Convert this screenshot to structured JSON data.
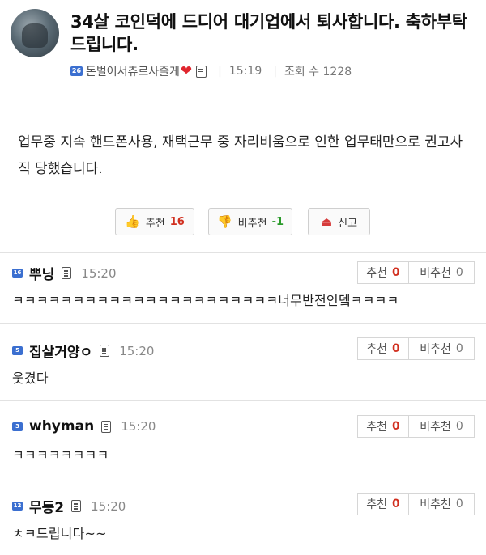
{
  "post": {
    "title": "34살 코인덕에 드디어 대기업에서 퇴사합니다. 축하부탁드립니다.",
    "author_level": "26",
    "author": "돈벌어서츄르사줄게",
    "time": "15:19",
    "views_label": "조회 수",
    "views": "1228",
    "body": "업무중 지속 핸드폰사용, 재택근무 중 자리비움으로 인한 업무태만으로 권고사직 당했습니다."
  },
  "votes": {
    "up_label": "추천",
    "up_count": "16",
    "down_label": "비추천",
    "down_count": "-1",
    "report_label": "신고"
  },
  "comments": [
    {
      "level": "16",
      "nick": "뿌닝",
      "time": "15:20",
      "up_label": "추천",
      "up": "0",
      "down_label": "비추천",
      "down": "0",
      "text": "ㅋㅋㅋㅋㅋㅋㅋㅋㅋㅋㅋㅋㅋㅋㅋㅋㅋㅋㅋㅋㅋㅋ너무반전인뎈ㅋㅋㅋㅋ"
    },
    {
      "level": "5",
      "nick": "집살거양ㅇ",
      "time": "15:20",
      "up_label": "추천",
      "up": "0",
      "down_label": "비추천",
      "down": "0",
      "text": "웃겼다"
    },
    {
      "level": "3",
      "nick": "whyman",
      "time": "15:20",
      "up_label": "추천",
      "up": "0",
      "down_label": "비추천",
      "down": "0",
      "text": "ㅋㅋㅋㅋㅋㅋㅋㅋ"
    },
    {
      "level": "12",
      "nick": "무등2",
      "time": "15:20",
      "up_label": "추천",
      "up": "0",
      "down_label": "비추천",
      "down": "0",
      "text": "ㅊㅋ드립니다~~"
    }
  ],
  "colors": {
    "accent_red": "#d12f1f",
    "accent_green": "#2a9a2a",
    "level_badge": "#3b6fd0",
    "heart": "#e0262e"
  },
  "icons": [
    "avatar",
    "level-badge",
    "heart-icon",
    "document-icon",
    "thumb-up-icon",
    "thumb-down-icon",
    "alarm-icon"
  ]
}
